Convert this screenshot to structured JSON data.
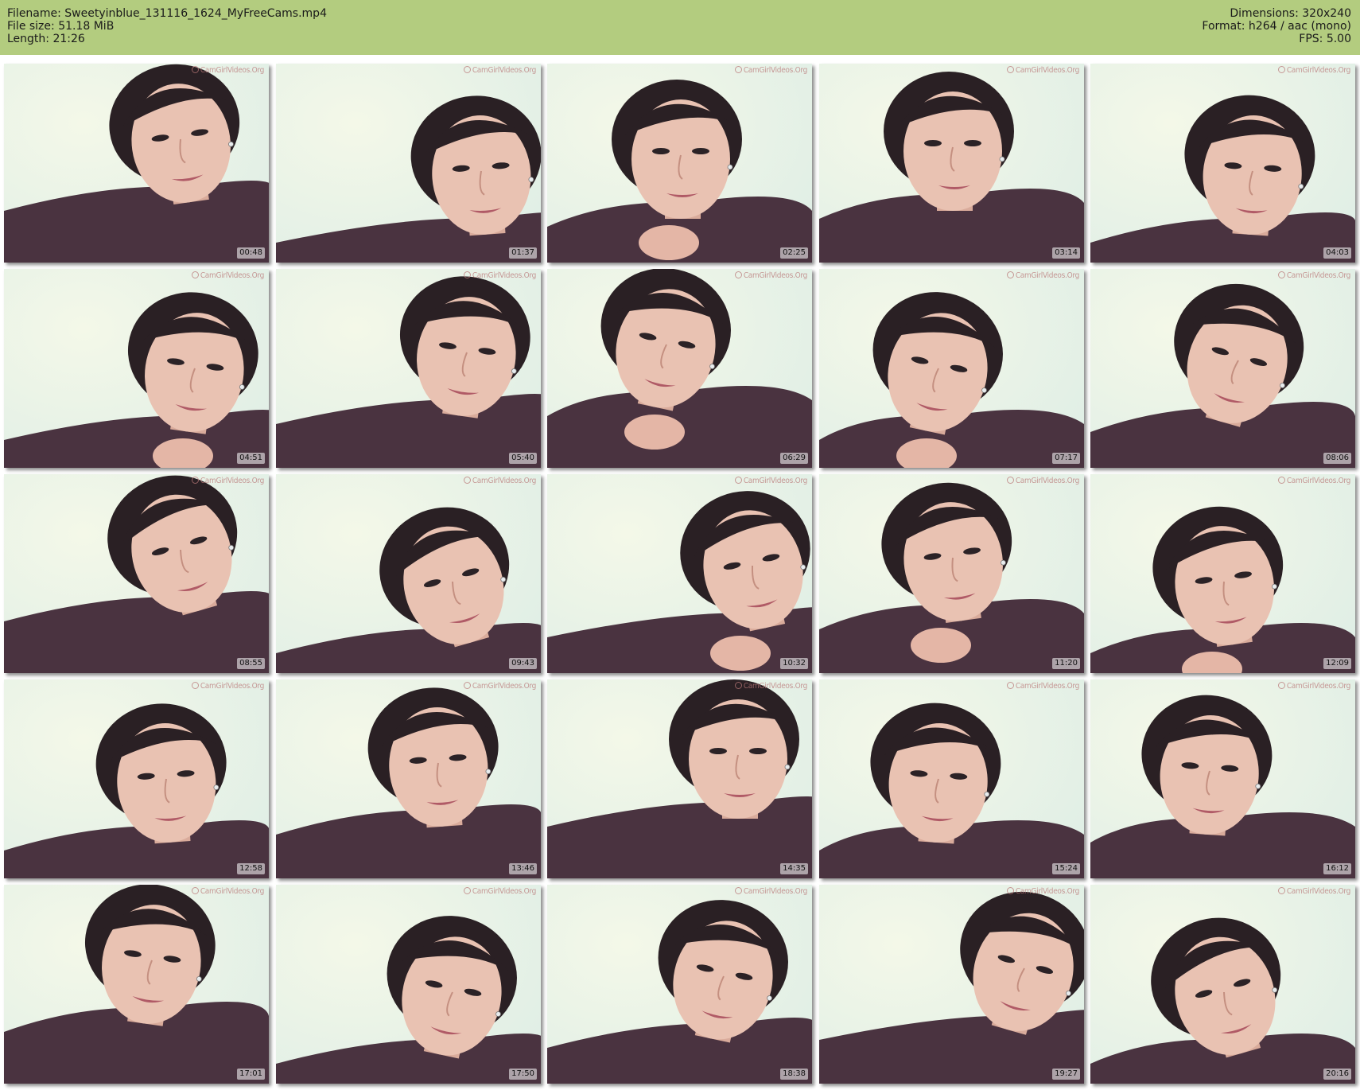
{
  "header": {
    "filename": "Filename: Sweetyinblue_131116_1624_MyFreeCams.mp4",
    "filesize": "File size: 51.18 MiB",
    "length": "Length: 21:26",
    "dimensions": "Dimensions: 320x240",
    "format": "Format: h264 / aac (mono)",
    "fps": "FPS: 5.00"
  },
  "watermark": "CamGirlVideos.Org",
  "colors": {
    "header_bg": "#b3cc7f",
    "sweater": "#4a3340",
    "hair": "#2a2024",
    "skin": "#e9c2b2",
    "wall": "#dfeee6"
  },
  "thumbnails": [
    {
      "time": "00:48"
    },
    {
      "time": "01:37"
    },
    {
      "time": "02:25"
    },
    {
      "time": "03:14"
    },
    {
      "time": "04:03"
    },
    {
      "time": "04:51"
    },
    {
      "time": "05:40"
    },
    {
      "time": "06:29"
    },
    {
      "time": "07:17"
    },
    {
      "time": "08:06"
    },
    {
      "time": "08:55"
    },
    {
      "time": "09:43"
    },
    {
      "time": "10:32"
    },
    {
      "time": "11:20"
    },
    {
      "time": "12:09"
    },
    {
      "time": "12:58"
    },
    {
      "time": "13:46"
    },
    {
      "time": "14:35"
    },
    {
      "time": "15:24"
    },
    {
      "time": "16:12"
    },
    {
      "time": "17:01"
    },
    {
      "time": "17:50"
    },
    {
      "time": "18:38"
    },
    {
      "time": "19:27"
    },
    {
      "time": "20:16"
    }
  ]
}
